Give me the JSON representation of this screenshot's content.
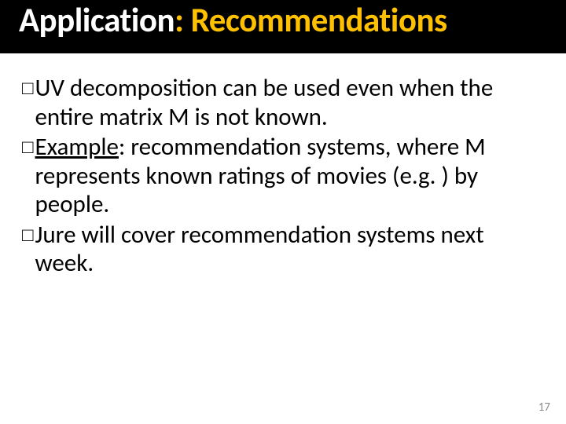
{
  "title": {
    "seg1": "Application",
    "seg2": ": Recommendations"
  },
  "bullets": [
    {
      "lead": "UV",
      "rest": " decomposition can be used even when the entire matrix M is not known.",
      "underline_lead": false
    },
    {
      "lead": "Example",
      "rest": ": recommendation systems, where M represents known ratings of movies (e.g. ) by people.",
      "underline_lead": true
    },
    {
      "lead": "Jure",
      "rest": " will cover recommendation systems next week.",
      "underline_lead": false
    }
  ],
  "bullet_glyph": "□",
  "page_number": "17"
}
